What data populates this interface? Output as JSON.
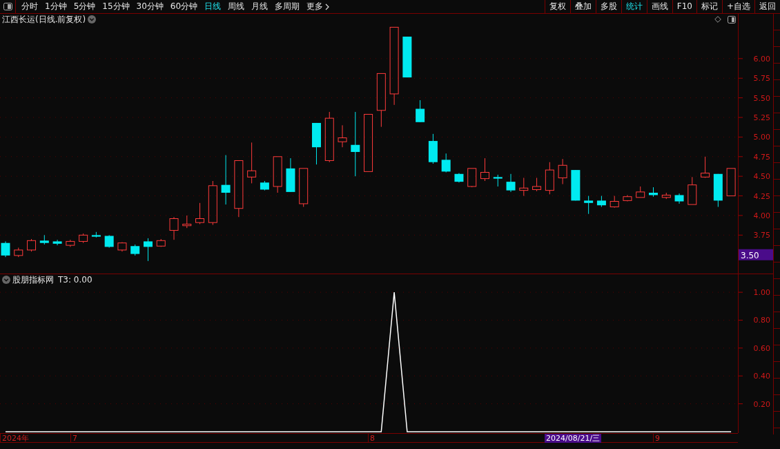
{
  "toolbar": {
    "periods": [
      {
        "label": "分时",
        "selected": false
      },
      {
        "label": "1分钟",
        "selected": false
      },
      {
        "label": "5分钟",
        "selected": false
      },
      {
        "label": "15分钟",
        "selected": false
      },
      {
        "label": "30分钟",
        "selected": false
      },
      {
        "label": "60分钟",
        "selected": false
      },
      {
        "label": "日线",
        "selected": true
      },
      {
        "label": "周线",
        "selected": false
      },
      {
        "label": "月线",
        "selected": false
      },
      {
        "label": "多周期",
        "selected": false
      }
    ],
    "more": "更多",
    "actions": [
      {
        "label": "复权",
        "selected": false
      },
      {
        "label": "叠加",
        "selected": false
      },
      {
        "label": "多股",
        "selected": false
      },
      {
        "label": "统计",
        "selected": true
      },
      {
        "label": "画线",
        "selected": false
      },
      {
        "label": "F10",
        "selected": false
      },
      {
        "label": "标记",
        "selected": false
      },
      {
        "label": "+自选",
        "selected": false
      },
      {
        "label": "返回",
        "selected": false
      }
    ]
  },
  "main_chart": {
    "title": "江西长运(日线.前复权)",
    "chart_data": {
      "type": "candlestick",
      "grid": true,
      "ylim": [
        3.26,
        6.43
      ],
      "yticks": [
        {
          "value": 3.75,
          "label": "3.75"
        },
        {
          "value": 4,
          "label": "4.00"
        },
        {
          "value": 4.25,
          "label": "4.25"
        },
        {
          "value": 4.5,
          "label": "4.50"
        },
        {
          "value": 4.75,
          "label": "4.75"
        },
        {
          "value": 5,
          "label": "5.00"
        },
        {
          "value": 5.25,
          "label": "5.25"
        },
        {
          "value": 5.5,
          "label": "5.50"
        },
        {
          "value": 5.75,
          "label": "5.75"
        },
        {
          "value": 6,
          "label": "6.00"
        }
      ],
      "annotations": [
        "3.50"
      ],
      "ohlc": [
        [
          3.65,
          3.67,
          3.47,
          3.49
        ],
        [
          3.49,
          3.59,
          3.47,
          3.56
        ],
        [
          3.56,
          3.7,
          3.54,
          3.68
        ],
        [
          3.68,
          3.75,
          3.63,
          3.65
        ],
        [
          3.67,
          3.69,
          3.62,
          3.64
        ],
        [
          3.62,
          3.69,
          3.6,
          3.67
        ],
        [
          3.67,
          3.77,
          3.65,
          3.75
        ],
        [
          3.75,
          3.79,
          3.72,
          3.73
        ],
        [
          3.74,
          3.75,
          3.59,
          3.6
        ],
        [
          3.56,
          3.66,
          3.54,
          3.65
        ],
        [
          3.61,
          3.63,
          3.49,
          3.51
        ],
        [
          3.67,
          3.71,
          3.42,
          3.6
        ],
        [
          3.61,
          3.7,
          3.6,
          3.68
        ],
        [
          3.81,
          3.98,
          3.69,
          3.96
        ],
        [
          3.87,
          4.0,
          3.84,
          3.89
        ],
        [
          3.91,
          4.16,
          3.89,
          3.96
        ],
        [
          3.91,
          4.44,
          3.88,
          4.38
        ],
        [
          4.39,
          4.77,
          4.14,
          4.29
        ],
        [
          4.09,
          4.7,
          3.98,
          4.7
        ],
        [
          4.49,
          4.93,
          4.41,
          4.57
        ],
        [
          4.42,
          4.44,
          4.32,
          4.33
        ],
        [
          4.37,
          4.75,
          4.29,
          4.75
        ],
        [
          4.6,
          4.73,
          4.3,
          4.3
        ],
        [
          4.15,
          4.6,
          4.11,
          4.6
        ],
        [
          5.18,
          5.18,
          4.65,
          4.87
        ],
        [
          4.7,
          5.32,
          4.68,
          5.24
        ],
        [
          4.94,
          5.15,
          4.87,
          4.99
        ],
        [
          4.9,
          5.32,
          4.5,
          4.81
        ],
        [
          4.56,
          5.29,
          4.56,
          5.29
        ],
        [
          5.34,
          5.81,
          5.13,
          5.81
        ],
        [
          5.55,
          6.4,
          5.41,
          6.4
        ],
        [
          6.28,
          6.28,
          5.76,
          5.76
        ],
        [
          5.36,
          5.47,
          5.19,
          5.19
        ],
        [
          4.95,
          5.04,
          4.66,
          4.68
        ],
        [
          4.71,
          4.79,
          4.55,
          4.56
        ],
        [
          4.53,
          4.54,
          4.42,
          4.43
        ],
        [
          4.37,
          4.6,
          4.36,
          4.6
        ],
        [
          4.47,
          4.73,
          4.44,
          4.55
        ],
        [
          4.49,
          4.52,
          4.37,
          4.47
        ],
        [
          4.43,
          4.53,
          4.3,
          4.32
        ],
        [
          4.32,
          4.48,
          4.25,
          4.35
        ],
        [
          4.33,
          4.48,
          4.31,
          4.37
        ],
        [
          4.32,
          4.68,
          4.27,
          4.58
        ],
        [
          4.48,
          4.72,
          4.4,
          4.64
        ],
        [
          4.58,
          4.58,
          4.19,
          4.19
        ],
        [
          4.19,
          4.25,
          4.02,
          4.16
        ],
        [
          4.19,
          4.25,
          4.11,
          4.13
        ],
        [
          4.11,
          4.25,
          4.1,
          4.18
        ],
        [
          4.19,
          4.26,
          4.18,
          4.24
        ],
        [
          4.23,
          4.37,
          4.23,
          4.3
        ],
        [
          4.29,
          4.36,
          4.24,
          4.26
        ],
        [
          4.23,
          4.29,
          4.21,
          4.26
        ],
        [
          4.26,
          4.28,
          4.15,
          4.18
        ],
        [
          4.14,
          4.49,
          4.14,
          4.39
        ],
        [
          4.49,
          4.75,
          4.48,
          4.54
        ],
        [
          4.53,
          4.53,
          4.11,
          4.19
        ],
        [
          4.25,
          4.6,
          4.25,
          4.6
        ]
      ]
    }
  },
  "date_axis": {
    "labels": [
      "2024年",
      "7",
      "8",
      "9"
    ],
    "cursor": "2024/08/21/三"
  },
  "indicator": {
    "title": "股朋指标网",
    "reading": "T3: 0.00",
    "chart_data": {
      "type": "line",
      "grid": true,
      "ylim": [
        -0.01,
        1.05
      ],
      "yticks": [
        {
          "value": 0.2,
          "label": "0.20"
        },
        {
          "value": 0.4,
          "label": "0.40"
        },
        {
          "value": 0.6,
          "label": "0.60"
        },
        {
          "value": 0.8,
          "label": "0.80"
        },
        {
          "value": 1,
          "label": "1.00"
        }
      ],
      "series": [
        {
          "color": "#ffffff",
          "values": [
            0,
            0,
            0,
            0,
            0,
            0,
            0,
            0,
            0,
            0,
            0,
            0,
            0,
            0,
            0,
            0,
            0,
            0,
            0,
            0,
            0,
            0,
            0,
            0,
            0,
            0,
            0,
            0,
            0,
            0,
            1,
            0,
            0,
            0,
            0,
            0,
            0,
            0,
            0,
            0,
            0,
            0,
            0,
            0,
            0,
            0,
            0,
            0,
            0,
            0,
            0,
            0,
            0,
            0,
            0,
            0,
            0
          ]
        }
      ]
    }
  }
}
